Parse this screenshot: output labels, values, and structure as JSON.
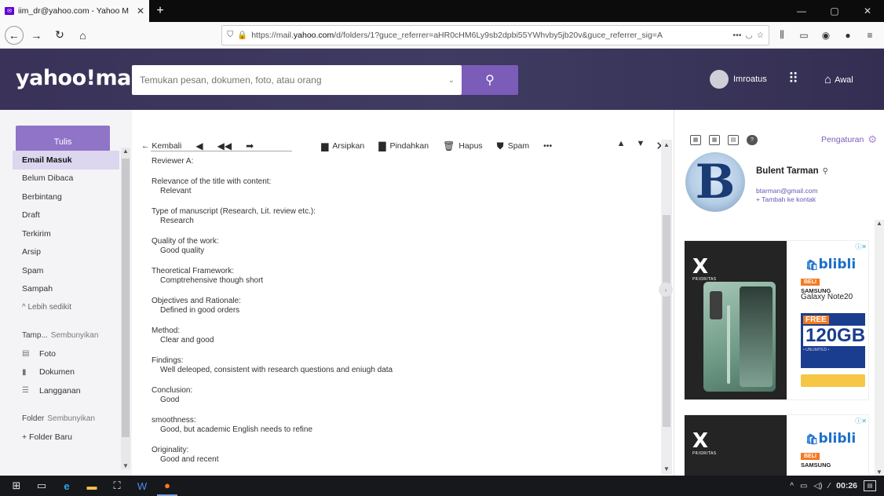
{
  "browser": {
    "tab_title": "iim_dr@yahoo.com - Yahoo M",
    "tab_close": "✕",
    "new_tab": "+",
    "window_controls": [
      "—",
      "▢",
      "✕"
    ],
    "url_prefix": "https://mail.",
    "url_domain": "yahoo.com",
    "url_rest": "/d/folders/1?guce_referrer=aHR0cHM6Ly9sb2dpbi55YWhvby5jb20v&guce_referrer_sig=A",
    "url_more": "•••"
  },
  "header": {
    "logo": "yahoo!mail",
    "search_placeholder": "Temukan pesan, dokumen, foto, atau orang",
    "user_name": "Imroatus",
    "home_label": "Awal"
  },
  "sidebar": {
    "compose_label": "Tulis",
    "folders": [
      {
        "label": "Email Masuk"
      },
      {
        "label": "Belum Dibaca"
      },
      {
        "label": "Berbintang"
      },
      {
        "label": "Draft"
      },
      {
        "label": "Terkirim"
      },
      {
        "label": "Arsip"
      },
      {
        "label": "Spam"
      },
      {
        "label": "Sampah"
      }
    ],
    "less_label": "^ Lebih sedikit",
    "views_section": "Tamp...",
    "views_hide": "Sembunyikan",
    "views": [
      {
        "label": "Foto"
      },
      {
        "label": "Dokumen"
      },
      {
        "label": "Langganan"
      }
    ],
    "folder_section": "Folder",
    "folder_hide": "Sembunyikan",
    "new_folder": "+ Folder Baru"
  },
  "toolbar": {
    "back_label": "← Kembali",
    "archive_label": "Arsipkan",
    "move_label": "Pindahkan",
    "delete_label": "Hapus",
    "spam_label": "Spam",
    "more_label": "•••"
  },
  "message": {
    "blocks": [
      {
        "q": "Reviewer A:",
        "a": ""
      },
      {
        "q": "Relevance of the title with content:",
        "a": "Relevant"
      },
      {
        "q": "Type of manuscript (Research, Lit. review etc.):",
        "a": "Research"
      },
      {
        "q": "Quality of the work:",
        "a": "Good quality"
      },
      {
        "q": "Theoretical Framework:",
        "a": "Comptrehensive though short"
      },
      {
        "q": "Objectives and Rationale:",
        "a": "Defined in good orders"
      },
      {
        "q": "Method:",
        "a": "Clear and good"
      },
      {
        "q": "Findings:",
        "a": "Well deleoped, consistent with research questions and eniugh data"
      },
      {
        "q": "Conclusion:",
        "a": "Good"
      },
      {
        "q": "smoothness:",
        "a": "Good, but academic English needs to refine"
      },
      {
        "q": "Originality:",
        "a": "Good and recent"
      }
    ]
  },
  "right_panel": {
    "settings_label": "Pengaturan",
    "contact_initial": "B",
    "contact_name": "Bulent Tarman",
    "contact_email": "btarman@gmail.com",
    "contact_add": "+ Tambah ke kontak"
  },
  "ads": {
    "brand_left": "X",
    "brand_left_sub": "PRIORITAS",
    "shop": "blibli",
    "beli": "BELI",
    "product_brand": "SAMSUNG",
    "product_name": "Galaxy Note20",
    "free": "FREE",
    "gb": "120GB",
    "unlimited": "• UNLIMITED •"
  },
  "taskbar": {
    "time": "00:26"
  },
  "colors": {
    "header_bg": "#3a3258",
    "compose_bg": "#8f74c8",
    "active_folder": "#ddd6ef",
    "accent": "#7b5cb8"
  }
}
